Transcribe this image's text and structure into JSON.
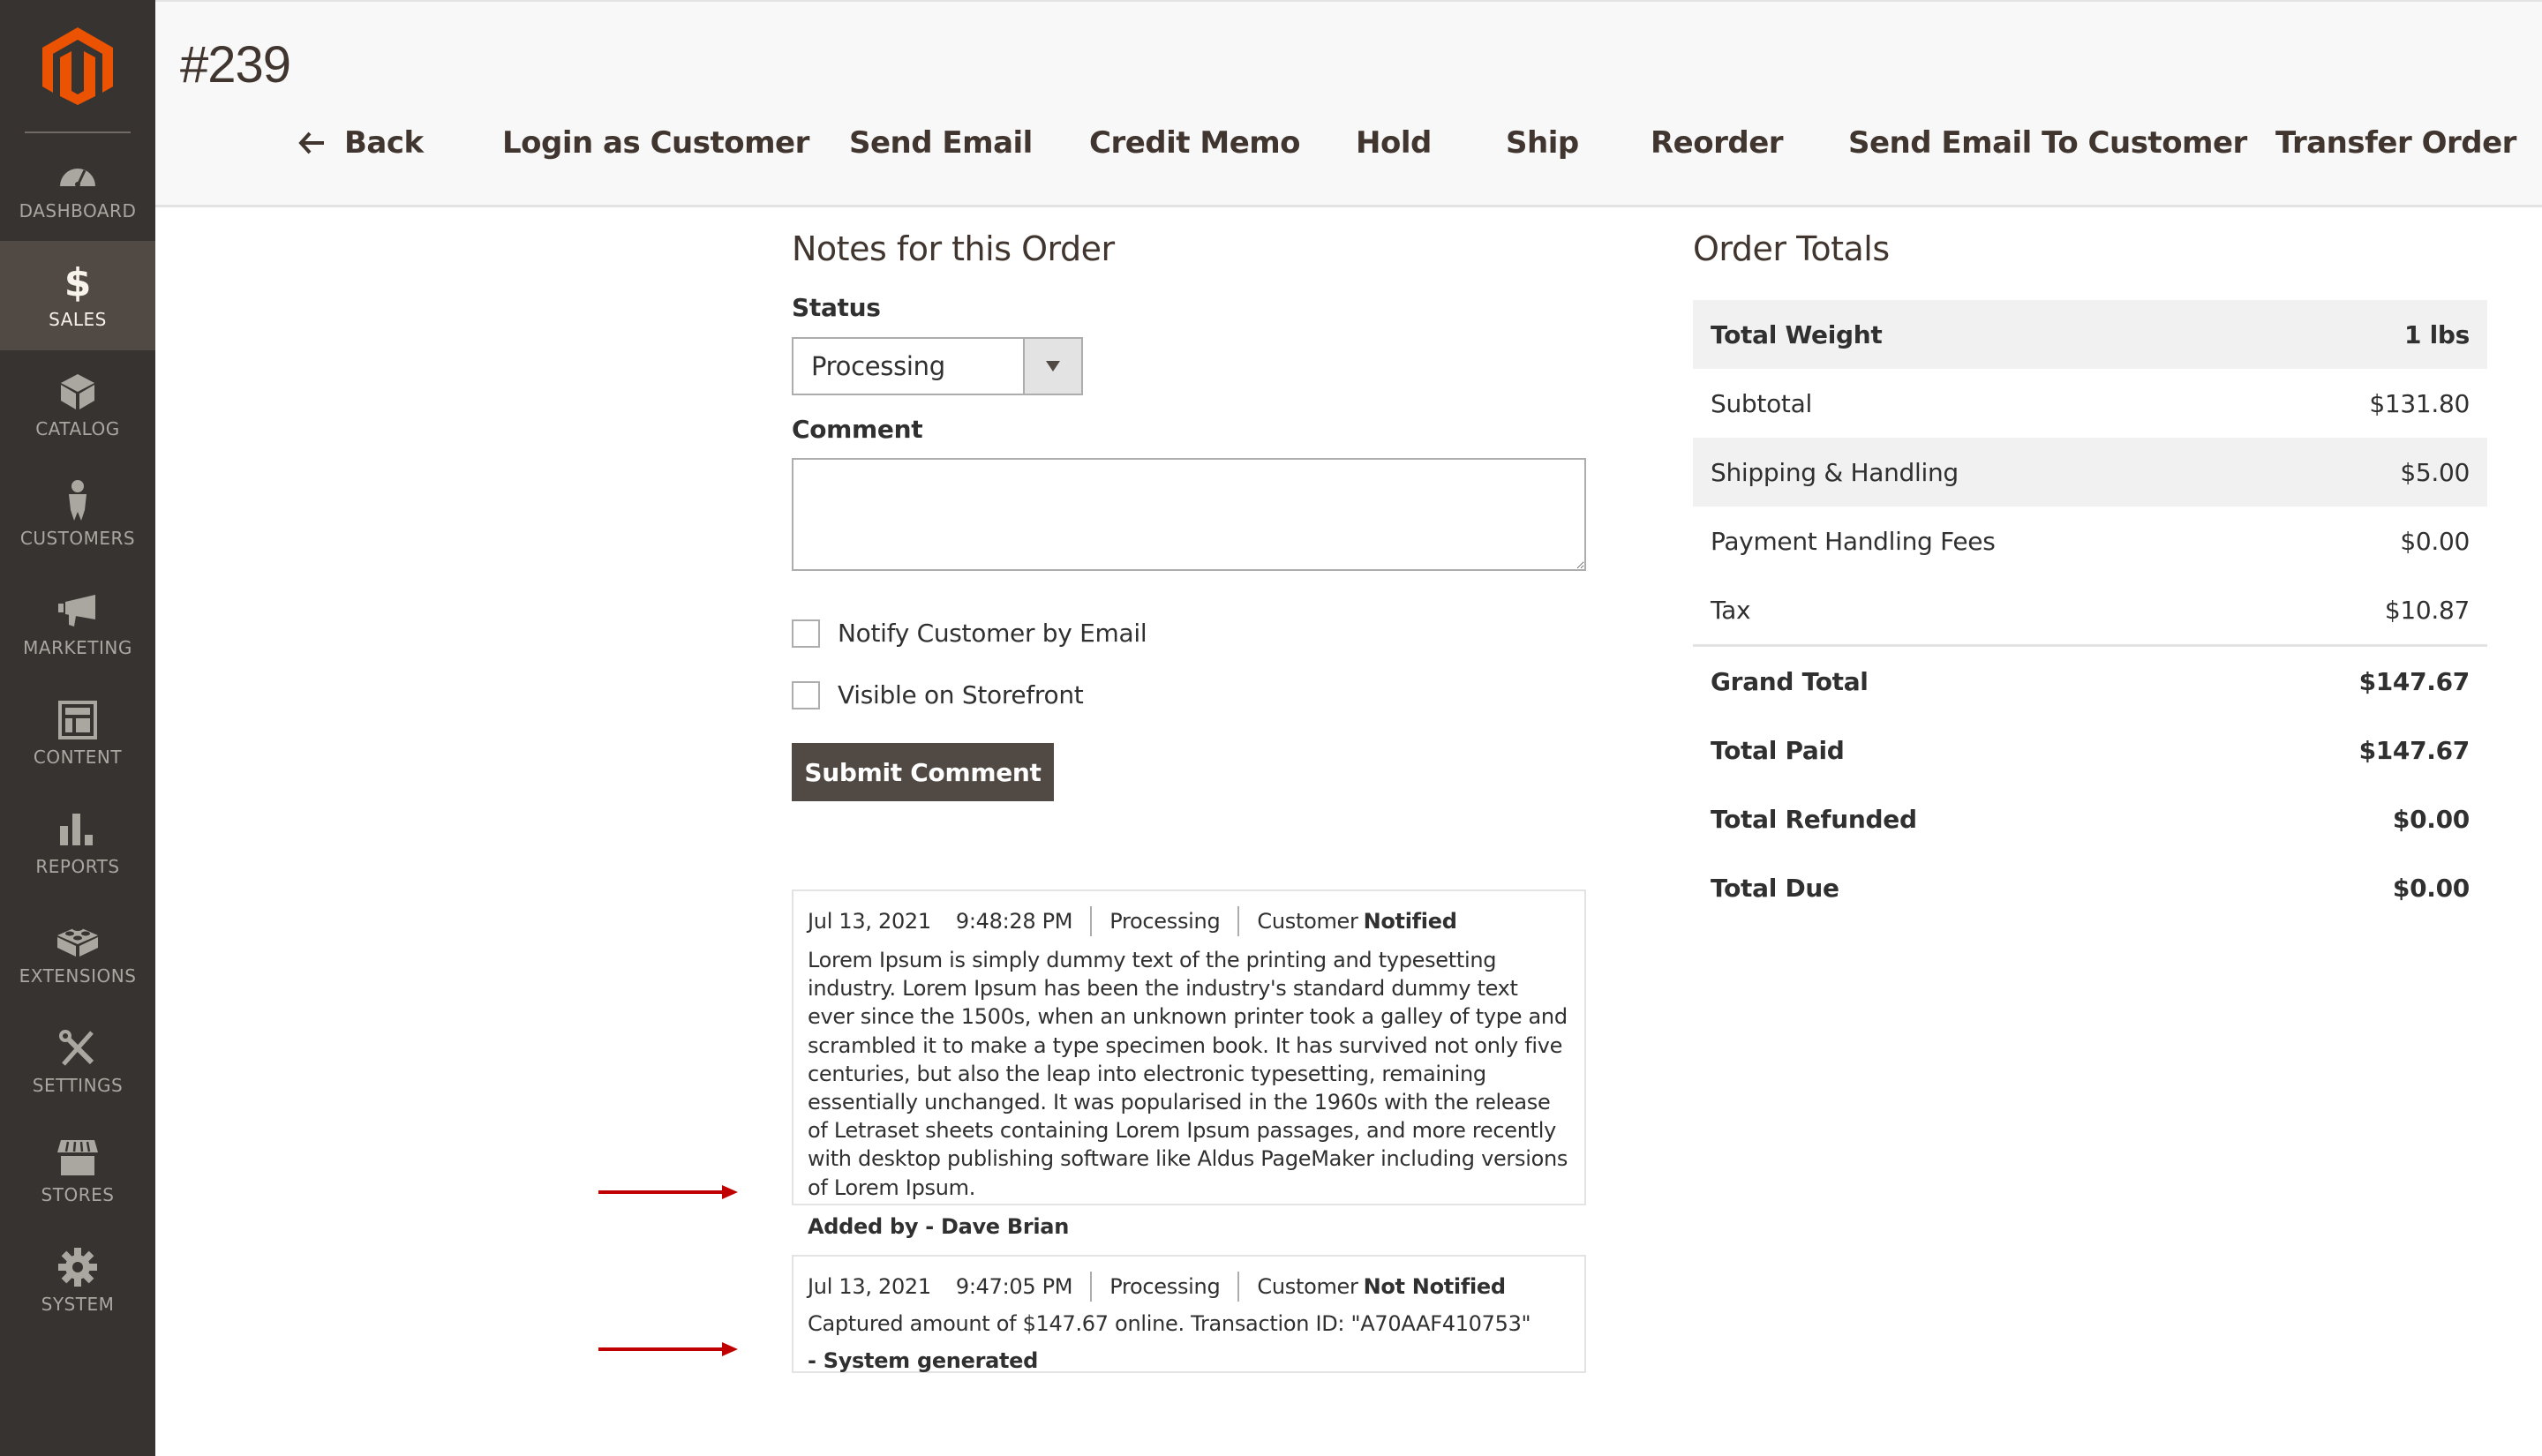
{
  "sidebar": {
    "logo": "magento-logo",
    "items": [
      {
        "label": "DASHBOARD",
        "icon": "dashboard-gauge-icon",
        "active": false
      },
      {
        "label": "SALES",
        "icon": "dollar-icon",
        "active": true
      },
      {
        "label": "CATALOG",
        "icon": "box-icon",
        "active": false
      },
      {
        "label": "CUSTOMERS",
        "icon": "person-icon",
        "active": false
      },
      {
        "label": "MARKETING",
        "icon": "megaphone-icon",
        "active": false
      },
      {
        "label": "CONTENT",
        "icon": "layout-icon",
        "active": false
      },
      {
        "label": "REPORTS",
        "icon": "bar-chart-icon",
        "active": false
      },
      {
        "label": "EXTENSIONS",
        "icon": "brick-icon",
        "active": false
      },
      {
        "label": "SETTINGS",
        "icon": "tools-icon",
        "active": false
      },
      {
        "label": "STORES",
        "icon": "storefront-icon",
        "active": false
      },
      {
        "label": "SYSTEM",
        "icon": "gear-icon",
        "active": false
      }
    ]
  },
  "header": {
    "title": "#239",
    "actions": [
      {
        "label": "Back",
        "icon": "arrow-left-icon"
      },
      {
        "label": "Login as Customer"
      },
      {
        "label": "Send Email"
      },
      {
        "label": "Credit Memo"
      },
      {
        "label": "Hold"
      },
      {
        "label": "Ship"
      },
      {
        "label": "Reorder"
      },
      {
        "label": "Send Email To Customer"
      },
      {
        "label": "Transfer Order"
      }
    ]
  },
  "notes": {
    "title": "Notes for this Order",
    "status_label": "Status",
    "status_value": "Processing",
    "comment_label": "Comment",
    "comment_value": "",
    "notify_label": "Notify Customer by Email",
    "notify_checked": false,
    "visible_label": "Visible on Storefront",
    "visible_checked": false,
    "submit_label": "Submit Comment",
    "history": [
      {
        "date": "Jul 13, 2021",
        "time": "9:48:28 PM",
        "status": "Processing",
        "customer_prefix": "Customer",
        "customer_state": "Notified",
        "text": "Lorem Ipsum is simply dummy text of the printing and typesetting industry. Lorem Ipsum has been the industry's standard dummy text ever since the 1500s, when an unknown printer took a galley of type and scrambled it to make a type specimen book. It has survived not only five centuries, but also the leap into electronic typesetting, remaining essentially unchanged. It was popularised in the 1960s with the release of Letraset sheets containing Lorem Ipsum passages, and more recently with desktop publishing software like Aldus PageMaker including versions of Lorem Ipsum.",
        "by": "Added by - Dave Brian"
      },
      {
        "date": "Jul 13, 2021",
        "time": "9:47:05 PM",
        "status": "Processing",
        "customer_prefix": "Customer",
        "customer_state": "Not Notified",
        "text": "Captured amount of $147.67 online. Transaction ID: \"A70AAF410753\"",
        "by": "- System generated"
      }
    ]
  },
  "totals": {
    "title": "Order Totals",
    "rows": [
      {
        "label": "Total Weight",
        "value": "1 lbs"
      },
      {
        "label": "Subtotal",
        "value": "$131.80"
      },
      {
        "label": "Shipping & Handling",
        "value": "$5.00"
      },
      {
        "label": "Payment Handling Fees",
        "value": "$0.00"
      },
      {
        "label": "Tax",
        "value": "$10.87"
      }
    ],
    "summary": [
      {
        "label": "Grand Total",
        "value": "$147.67"
      },
      {
        "label": "Total Paid",
        "value": "$147.67"
      },
      {
        "label": "Total Refunded",
        "value": "$0.00"
      },
      {
        "label": "Total Due",
        "value": "$0.00"
      }
    ]
  },
  "annotations": {
    "arrow_color": "#c00000"
  },
  "colors": {
    "brand": "#eb5202",
    "sidebar_bg": "#373330",
    "sidebar_active": "#514943",
    "button_dark": "#514943"
  }
}
